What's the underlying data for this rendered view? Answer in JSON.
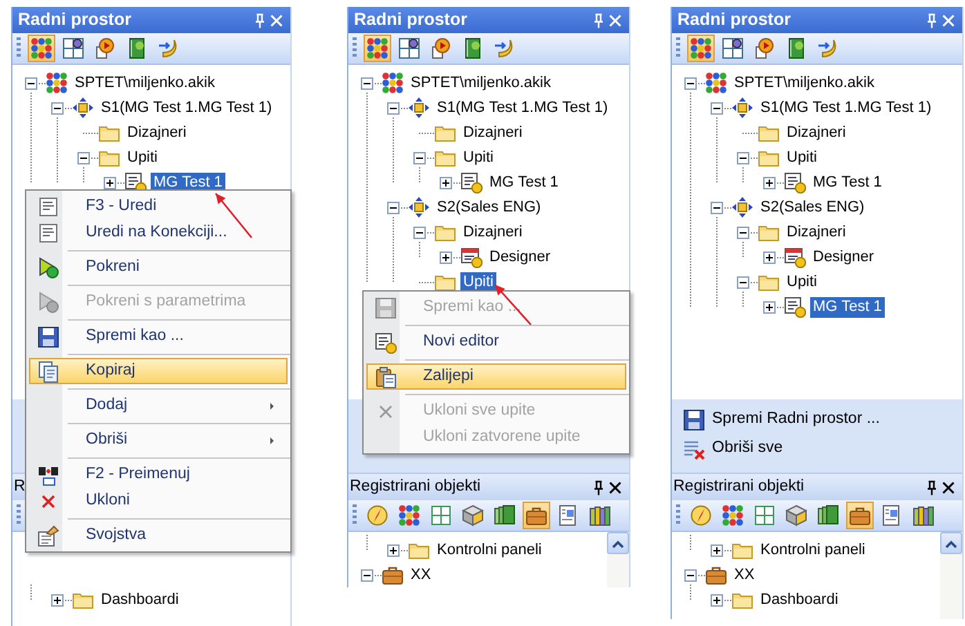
{
  "panels": [
    {
      "title": "Radni prostor",
      "toolbar": [
        {
          "kind": "objects",
          "selected": true
        },
        {
          "kind": "layout",
          "selected": false
        },
        {
          "kind": "run",
          "selected": false
        },
        {
          "kind": "book",
          "selected": false
        },
        {
          "kind": "connect",
          "selected": false
        }
      ],
      "tree": [
        {
          "label": "SPTET\\miljenko.akik",
          "kind": "server",
          "expanded": true,
          "selected": false,
          "children": [
            {
              "label": "S1(MG Test 1.MG Test 1)",
              "kind": "connection",
              "expanded": true,
              "selected": false,
              "children": [
                {
                  "label": "Dizajneri",
                  "kind": "folder",
                  "selected": false
                },
                {
                  "label": "Upiti",
                  "kind": "folder",
                  "expanded": true,
                  "selected": false,
                  "children": [
                    {
                      "label": "MG Test 1",
                      "kind": "query",
                      "expanded": false,
                      "selected": true
                    }
                  ]
                }
              ]
            }
          ]
        }
      ],
      "registry": {
        "title": "R",
        "tree": [
          {
            "children": [
              {
                "label": "Dashboardi",
                "kind": "folder",
                "expanded": false,
                "selected": false
              }
            ]
          }
        ]
      },
      "context_menu": {
        "items": [
          {
            "kind": "edit",
            "label": "F3 - Uredi",
            "disabled": false,
            "selected": false
          },
          {
            "kind": "edit",
            "label": "Uredi na Konekciji...",
            "disabled": false,
            "selected": false
          },
          {
            "kind": "separator"
          },
          {
            "kind": "run",
            "label": "Pokreni",
            "disabled": false,
            "selected": false
          },
          {
            "kind": "separator"
          },
          {
            "kind": "run",
            "label": "Pokreni s parametrima",
            "disabled": true,
            "selected": false
          },
          {
            "kind": "separator"
          },
          {
            "kind": "save",
            "label": "Spremi kao ...",
            "disabled": false,
            "selected": false
          },
          {
            "kind": "separator"
          },
          {
            "kind": "copy",
            "label": "Kopiraj",
            "disabled": false,
            "selected": true
          },
          {
            "kind": "separator"
          },
          {
            "kind": "plain",
            "label": "Dodaj",
            "disabled": false,
            "selected": false,
            "submenu": true
          },
          {
            "kind": "separator"
          },
          {
            "kind": "plain",
            "label": "Obriši",
            "disabled": false,
            "selected": false,
            "submenu": true
          },
          {
            "kind": "separator"
          },
          {
            "kind": "rename",
            "label": "F2 - Preimenuj",
            "disabled": false,
            "selected": false
          },
          {
            "kind": "remove",
            "label": "Ukloni",
            "disabled": false,
            "selected": false
          },
          {
            "kind": "separator"
          },
          {
            "kind": "properties",
            "label": "Svojstva",
            "disabled": false,
            "selected": false
          }
        ]
      }
    },
    {
      "title": "Radni prostor",
      "toolbar": [
        {
          "kind": "objects",
          "selected": true
        },
        {
          "kind": "layout",
          "selected": false
        },
        {
          "kind": "run",
          "selected": false
        },
        {
          "kind": "book",
          "selected": false
        },
        {
          "kind": "connect",
          "selected": false
        }
      ],
      "tree": [
        {
          "label": "SPTET\\miljenko.akik",
          "kind": "server",
          "expanded": true,
          "selected": false,
          "children": [
            {
              "label": "S1(MG Test 1.MG Test 1)",
              "kind": "connection",
              "expanded": true,
              "selected": false,
              "children": [
                {
                  "label": "Dizajneri",
                  "kind": "folder",
                  "selected": false
                },
                {
                  "label": "Upiti",
                  "kind": "folder",
                  "expanded": true,
                  "selected": false,
                  "children": [
                    {
                      "label": "MG Test 1",
                      "kind": "query",
                      "expanded": false,
                      "selected": false
                    }
                  ]
                }
              ]
            },
            {
              "label": "S2(Sales ENG)",
              "kind": "connection",
              "expanded": true,
              "selected": false,
              "children": [
                {
                  "label": "Dizajneri",
                  "kind": "folder",
                  "expanded": true,
                  "selected": false,
                  "children": [
                    {
                      "label": "Designer",
                      "kind": "designer",
                      "expanded": false,
                      "selected": false
                    }
                  ]
                },
                {
                  "label": "Upiti",
                  "kind": "folder",
                  "selected": true
                }
              ]
            }
          ]
        }
      ],
      "registry": {
        "title": "Registrirani objekti",
        "pin": true,
        "close": true,
        "scrollbar": true,
        "toolbar": [
          {
            "kind": "compass",
            "selected": false
          },
          {
            "kind": "objects",
            "selected": false
          },
          {
            "kind": "table",
            "selected": false
          },
          {
            "kind": "cube",
            "selected": false
          },
          {
            "kind": "stack",
            "selected": false
          },
          {
            "kind": "briefcase",
            "selected": true
          },
          {
            "kind": "report",
            "selected": false
          },
          {
            "kind": "books",
            "selected": false
          }
        ],
        "tree": [
          {
            "children": [
              {
                "label": "Kontrolni paneli",
                "kind": "folder",
                "expanded": false,
                "selected": false
              }
            ]
          },
          {
            "label": "XX",
            "kind": "briefcase",
            "expanded": true,
            "selected": false
          }
        ]
      },
      "context_menu": {
        "items": [
          {
            "kind": "save",
            "label": "Spremi kao ...",
            "disabled": true,
            "selected": false
          },
          {
            "kind": "separator"
          },
          {
            "kind": "query",
            "label": "Novi editor",
            "disabled": false,
            "selected": false
          },
          {
            "kind": "separator"
          },
          {
            "kind": "paste",
            "label": "Zalijepi",
            "disabled": false,
            "selected": true
          },
          {
            "kind": "separator"
          },
          {
            "kind": "remove",
            "label": "Ukloni sve upite",
            "disabled": true,
            "selected": false
          },
          {
            "kind": "plain",
            "label": "Ukloni zatvorene upite",
            "disabled": true,
            "selected": false
          }
        ]
      }
    },
    {
      "title": "Radni prostor",
      "toolbar": [
        {
          "kind": "objects",
          "selected": true
        },
        {
          "kind": "layout",
          "selected": false
        },
        {
          "kind": "run",
          "selected": false
        },
        {
          "kind": "book",
          "selected": false
        },
        {
          "kind": "connect",
          "selected": false
        }
      ],
      "tree": [
        {
          "label": "SPTET\\miljenko.akik",
          "kind": "server",
          "expanded": true,
          "selected": false,
          "children": [
            {
              "label": "S1(MG Test 1.MG Test 1)",
              "kind": "connection",
              "expanded": true,
              "selected": false,
              "children": [
                {
                  "label": "Dizajneri",
                  "kind": "folder",
                  "selected": false
                },
                {
                  "label": "Upiti",
                  "kind": "folder",
                  "expanded": true,
                  "selected": false,
                  "children": [
                    {
                      "label": "MG Test 1",
                      "kind": "query",
                      "expanded": false,
                      "selected": false
                    }
                  ]
                }
              ]
            },
            {
              "label": "S2(Sales ENG)",
              "kind": "connection",
              "expanded": true,
              "selected": false,
              "children": [
                {
                  "label": "Dizajneri",
                  "kind": "folder",
                  "expanded": true,
                  "selected": false,
                  "children": [
                    {
                      "label": "Designer",
                      "kind": "designer",
                      "expanded": false,
                      "selected": false
                    }
                  ]
                },
                {
                  "label": "Upiti",
                  "kind": "folder",
                  "expanded": true,
                  "selected": false,
                  "children": [
                    {
                      "label": "MG Test 1",
                      "kind": "query",
                      "expanded": false,
                      "selected": true
                    }
                  ]
                }
              ]
            }
          ]
        }
      ],
      "task_pane": [
        {
          "kind": "save",
          "label": "Spremi Radni prostor ..."
        },
        {
          "kind": "clear",
          "label": "Obriši sve"
        }
      ],
      "registry": {
        "title": "Registrirani objekti",
        "pin": true,
        "close": true,
        "scrollbar": true,
        "toolbar": [
          {
            "kind": "compass",
            "selected": false
          },
          {
            "kind": "objects",
            "selected": false
          },
          {
            "kind": "table",
            "selected": false
          },
          {
            "kind": "cube",
            "selected": false
          },
          {
            "kind": "stack",
            "selected": false
          },
          {
            "kind": "briefcase",
            "selected": true
          },
          {
            "kind": "report",
            "selected": false
          },
          {
            "kind": "books",
            "selected": false
          }
        ],
        "tree": [
          {
            "children": [
              {
                "label": "Kontrolni paneli",
                "kind": "folder",
                "expanded": false,
                "selected": false
              }
            ]
          },
          {
            "label": "XX",
            "kind": "briefcase",
            "expanded": true,
            "selected": false,
            "children": [
              {
                "label": "Dashboardi",
                "kind": "folder",
                "expanded": false,
                "selected": false
              }
            ]
          }
        ]
      }
    }
  ]
}
